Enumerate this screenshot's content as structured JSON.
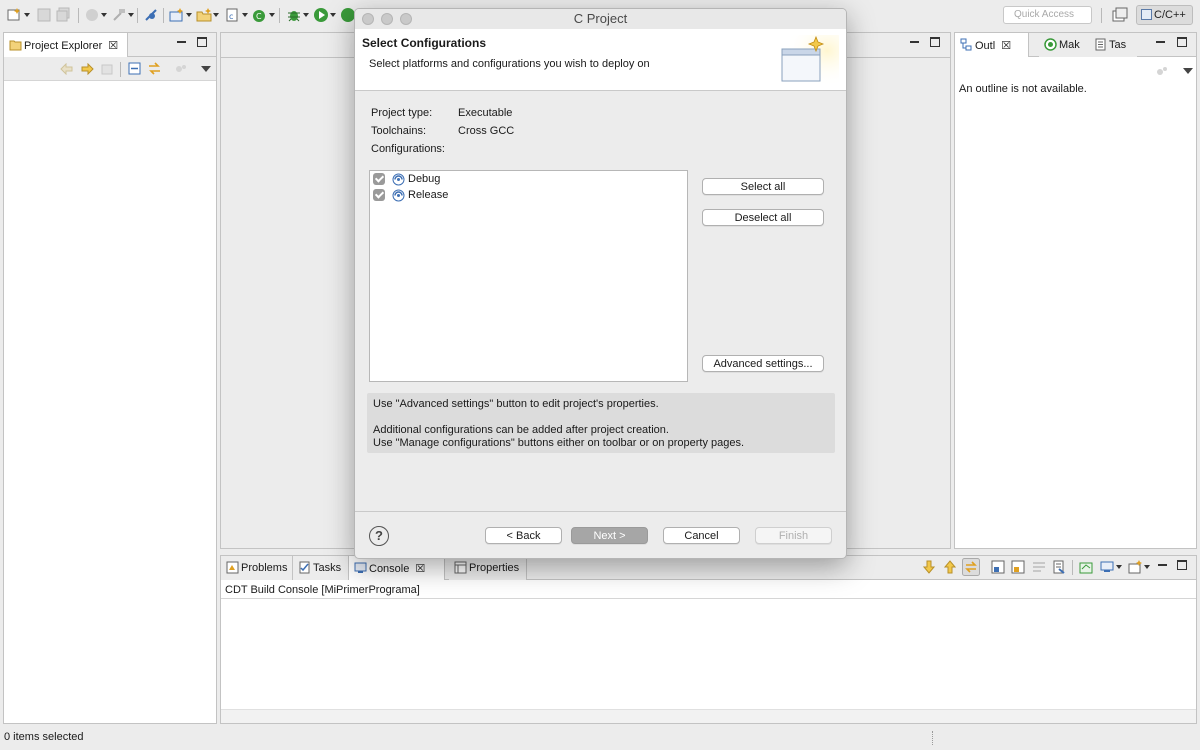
{
  "toolbar": {
    "quick_access_placeholder": "Quick Access",
    "perspective_label": "C/C++"
  },
  "project_explorer": {
    "tab_label": "Project Explorer",
    "close_glyph": "☒"
  },
  "outline_panel": {
    "tabs": [
      {
        "label": "Outl",
        "close_glyph": "☒"
      },
      {
        "label": "Mak"
      },
      {
        "label": "Tas"
      }
    ],
    "empty_message": "An outline is not available."
  },
  "bottom_panel": {
    "tabs": [
      {
        "label": "Problems"
      },
      {
        "label": "Tasks"
      },
      {
        "label": "Console",
        "close_glyph": "☒"
      },
      {
        "label": "Properties"
      }
    ],
    "console_title": "CDT Build Console [MiPrimerPrograma]"
  },
  "status_bar": {
    "text": "0 items selected"
  },
  "dialog": {
    "window_title": "C Project",
    "heading": "Select Configurations",
    "subtitle": "Select platforms and configurations you wish to deploy on",
    "project_type_label": "Project type:",
    "project_type_value": "Executable",
    "toolchains_label": "Toolchains:",
    "toolchains_value": "Cross GCC",
    "configurations_label": "Configurations:",
    "configurations": [
      {
        "label": "Debug",
        "checked": true
      },
      {
        "label": "Release",
        "checked": true
      }
    ],
    "select_all_label": "Select all",
    "deselect_all_label": "Deselect all",
    "advanced_label": "Advanced settings...",
    "notes": [
      "Use \"Advanced settings\" button to edit project's properties.",
      "Additional configurations can be added after project creation.",
      "Use \"Manage configurations\" buttons either on toolbar or on property pages."
    ],
    "help_glyph": "?",
    "back_label": "< Back",
    "next_label": "Next >",
    "cancel_label": "Cancel",
    "finish_label": "Finish"
  },
  "colors": {
    "accent_green": "#3a9a3a",
    "accent_blue": "#3d6fb4",
    "accent_orange": "#e0a020"
  }
}
